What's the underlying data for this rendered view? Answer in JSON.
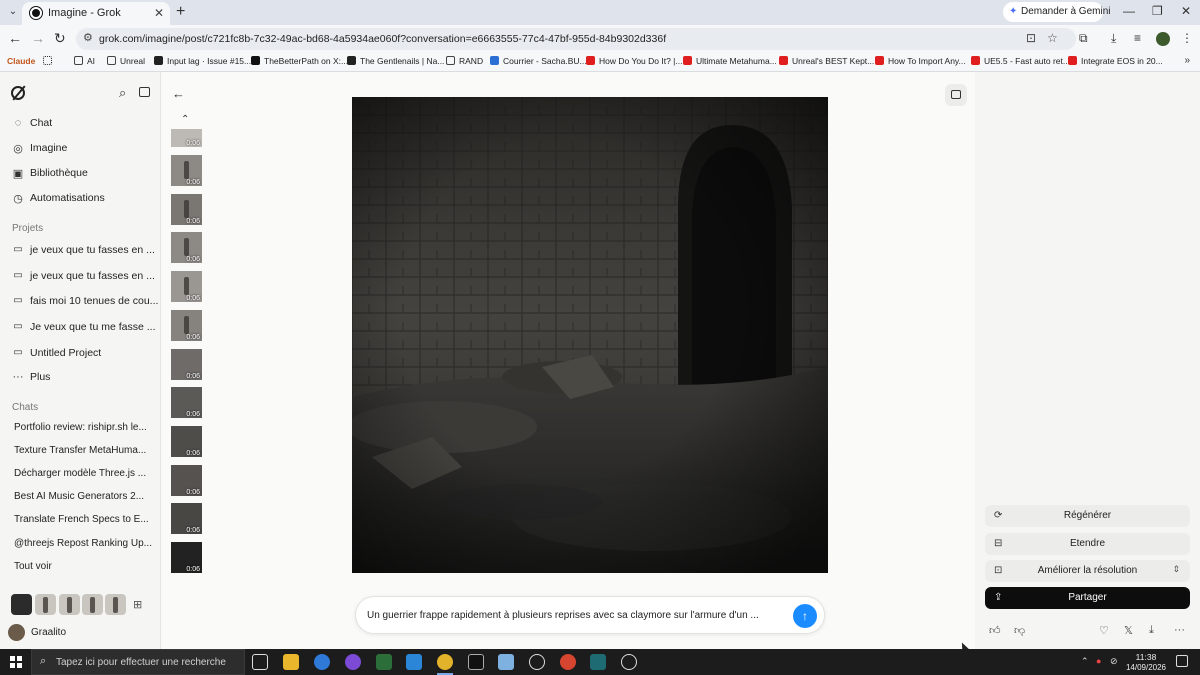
{
  "browser": {
    "tab_title": "Imagine - Grok",
    "gemini_button": "Demander à Gemini",
    "url": "grok.com/imagine/post/c721fc8b-7c32-49ac-bd68-4a5934ae060f?conversation=e6663555-77c4-47bf-955d-84b9302d336f",
    "bookmarks": [
      "Claude",
      "AI",
      "Unreal",
      "Input lag · Issue #15...",
      "TheBetterPath on X:...",
      "The Gentlenails | Na...",
      "RAND",
      "Courrier - Sacha.BU...",
      "How Do You Do It? |...",
      "Ultimate Metahuma...",
      "Unreal's BEST Kept...",
      "How To Import Any...",
      "UE5.5 - Fast auto ret...",
      "Integrate EOS in 20..."
    ]
  },
  "sidebar": {
    "nav": [
      {
        "label": "Chat",
        "icon": "chat-icon"
      },
      {
        "label": "Imagine",
        "icon": "imagine-icon"
      },
      {
        "label": "Bibliothèque",
        "icon": "library-icon"
      },
      {
        "label": "Automatisations",
        "icon": "clock-icon"
      }
    ],
    "projects_label": "Projets",
    "projects": [
      "je veux que tu fasses en ...",
      "je veux que tu fasses en ...",
      "fais moi 10 tenues de cou...",
      "Je veux que tu me fasse ...",
      "Untitled Project"
    ],
    "more_label": "Plus",
    "chats_label": "Chats",
    "chats": [
      "Portfolio review: rishipr.sh le...",
      "Texture Transfer MetaHuma...",
      "Décharger modèle Three.js ...",
      "Best AI Music Generators 2...",
      "Translate French Specs to E...",
      "@threejs Repost Ranking Up..."
    ],
    "see_all": "Tout voir",
    "user_name": "Graalito"
  },
  "thumbnails": {
    "durations": [
      "0:06",
      "0:06",
      "0:06",
      "0:06",
      "0:06",
      "0:06",
      "0:06",
      "0:06",
      "0:06",
      "0:06",
      "0:06",
      "0:06"
    ]
  },
  "prompt": {
    "text": "Un guerrier frappe rapidement à plusieurs reprises avec sa claymore sur l'armure d'un ..."
  },
  "actions": {
    "regenerate": "Régénérer",
    "extend": "Etendre",
    "upscale": "Améliorer la résolution",
    "share": "Partager"
  },
  "taskbar": {
    "search_placeholder": "Tapez ici pour effectuer une recherche",
    "time": "11:38",
    "date": "14/09/2026"
  },
  "colors": {
    "accent_blue": "#1a8cff",
    "share_button": "#0d0d0d"
  }
}
